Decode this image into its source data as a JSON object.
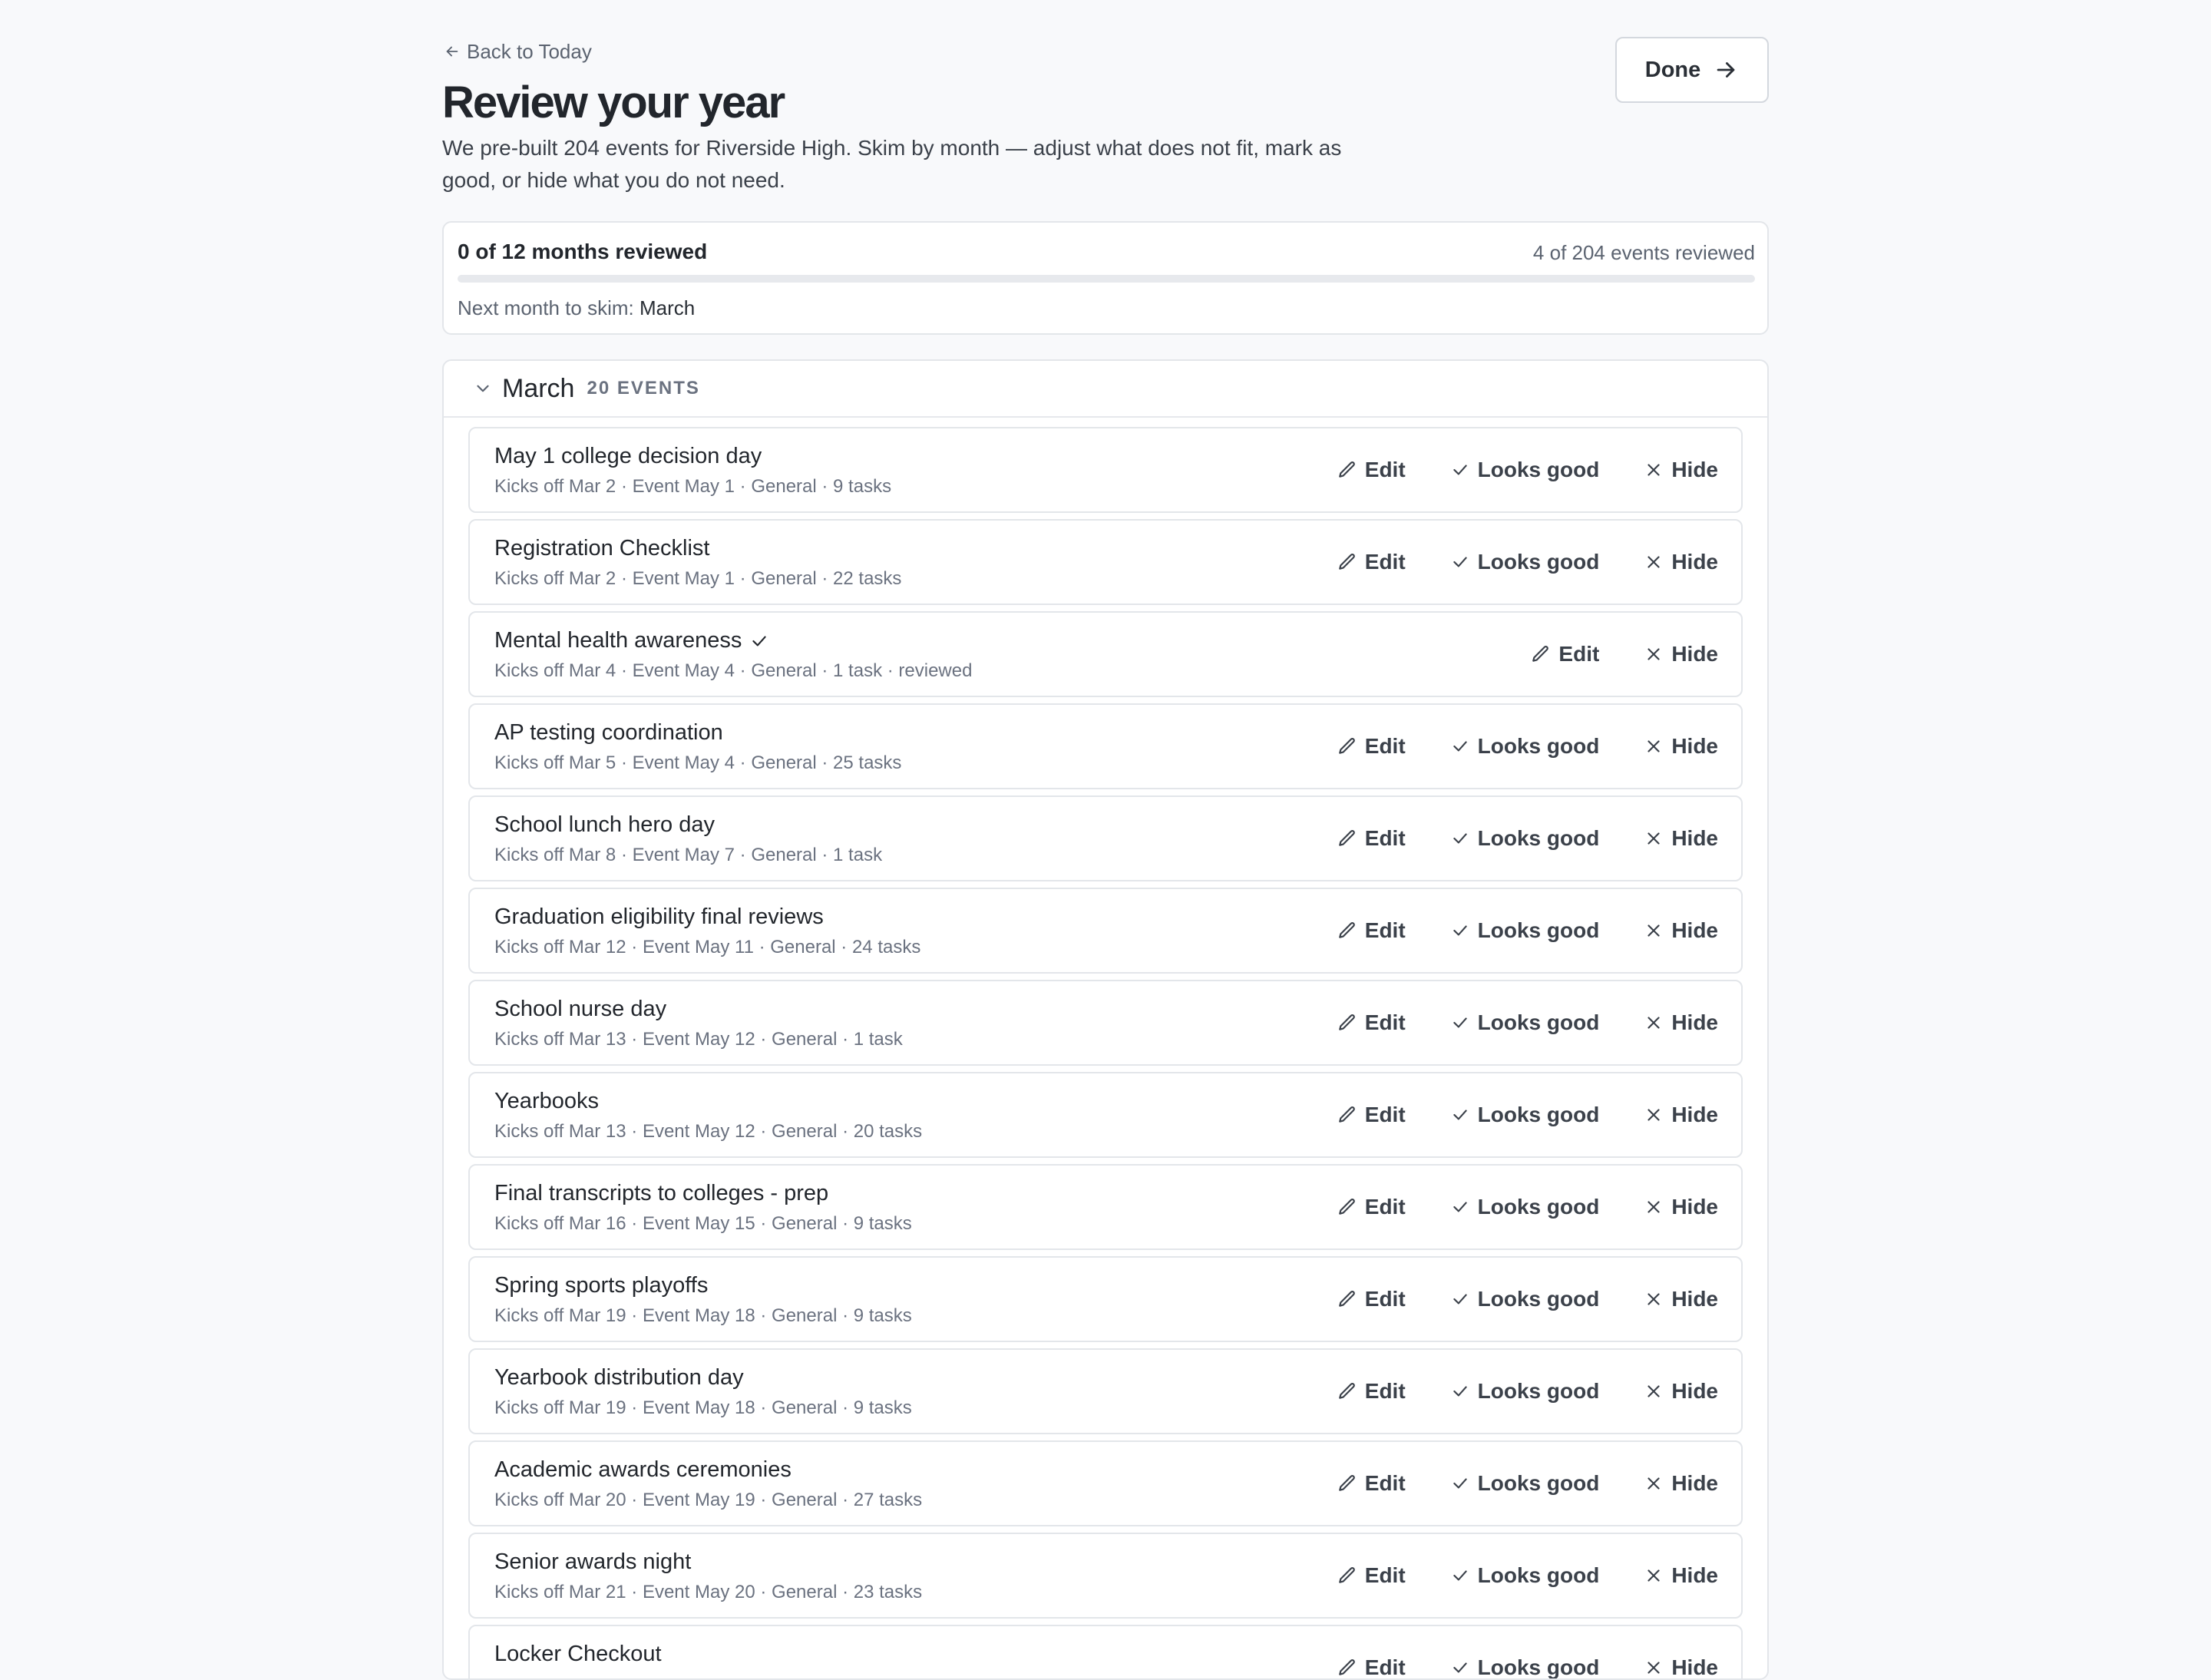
{
  "header": {
    "back_label": "Back to Today",
    "title": "Review your year",
    "subtitle": "We pre-built 204 events for Riverside High. Skim by month — adjust what does not fit, mark as good, or hide what you do not need.",
    "done_label": "Done"
  },
  "progress": {
    "months_text": "0 of 12 months reviewed",
    "events_text": "4 of 204 events reviewed",
    "progress_fraction": 0,
    "next_label": "Next month to skim:",
    "next_month": "March"
  },
  "month": {
    "name": "March",
    "count_label": "20 EVENTS"
  },
  "actions": {
    "edit": "Edit",
    "looks_good": "Looks good",
    "hide": "Hide"
  },
  "events": [
    {
      "title": "May 1 college decision day",
      "meta": "Kicks off Mar 2 · Event May 1 · General · 9 tasks",
      "reviewed": false
    },
    {
      "title": "Registration Checklist",
      "meta": "Kicks off Mar 2 · Event May 1 · General · 22 tasks",
      "reviewed": false
    },
    {
      "title": "Mental health awareness",
      "meta": "Kicks off Mar 4 · Event May 4 · General · 1 task · reviewed",
      "reviewed": true
    },
    {
      "title": "AP testing coordination",
      "meta": "Kicks off Mar 5 · Event May 4 · General · 25 tasks",
      "reviewed": false
    },
    {
      "title": "School lunch hero day",
      "meta": "Kicks off Mar 8 · Event May 7 · General · 1 task",
      "reviewed": false
    },
    {
      "title": "Graduation eligibility final reviews",
      "meta": "Kicks off Mar 12 · Event May 11 · General · 24 tasks",
      "reviewed": false
    },
    {
      "title": "School nurse day",
      "meta": "Kicks off Mar 13 · Event May 12 · General · 1 task",
      "reviewed": false
    },
    {
      "title": "Yearbooks",
      "meta": "Kicks off Mar 13 · Event May 12 · General · 20 tasks",
      "reviewed": false
    },
    {
      "title": "Final transcripts to colleges - prep",
      "meta": "Kicks off Mar 16 · Event May 15 · General · 9 tasks",
      "reviewed": false
    },
    {
      "title": "Spring sports playoffs",
      "meta": "Kicks off Mar 19 · Event May 18 · General · 9 tasks",
      "reviewed": false
    },
    {
      "title": "Yearbook distribution day",
      "meta": "Kicks off Mar 19 · Event May 18 · General · 9 tasks",
      "reviewed": false
    },
    {
      "title": "Academic awards ceremonies",
      "meta": "Kicks off Mar 20 · Event May 19 · General · 27 tasks",
      "reviewed": false
    },
    {
      "title": "Senior awards night",
      "meta": "Kicks off Mar 21 · Event May 20 · General · 23 tasks",
      "reviewed": false
    },
    {
      "title": "Locker Checkout",
      "meta": "",
      "reviewed": false
    }
  ]
}
